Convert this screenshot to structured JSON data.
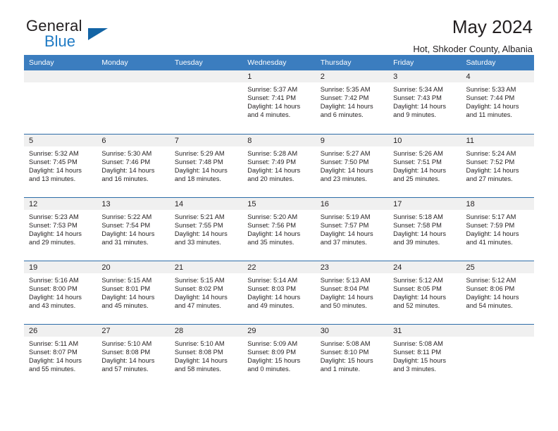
{
  "brand": {
    "name_part1": "General",
    "name_part2": "Blue"
  },
  "header": {
    "title": "May 2024",
    "subtitle": "Hot, Shkoder County, Albania"
  },
  "colors": {
    "header_blue": "#3b7dbf",
    "row_divider": "#2d6ca8",
    "daynum_bg": "#f0f0f0",
    "brand_blue": "#1f7ac4",
    "text": "#231f20"
  },
  "weekday_headers": [
    "Sunday",
    "Monday",
    "Tuesday",
    "Wednesday",
    "Thursday",
    "Friday",
    "Saturday"
  ],
  "weeks": [
    [
      {
        "day": "",
        "sunrise": "",
        "sunset": "",
        "daylight1": "",
        "daylight2": ""
      },
      {
        "day": "",
        "sunrise": "",
        "sunset": "",
        "daylight1": "",
        "daylight2": ""
      },
      {
        "day": "",
        "sunrise": "",
        "sunset": "",
        "daylight1": "",
        "daylight2": ""
      },
      {
        "day": "1",
        "sunrise": "Sunrise: 5:37 AM",
        "sunset": "Sunset: 7:41 PM",
        "daylight1": "Daylight: 14 hours",
        "daylight2": "and 4 minutes."
      },
      {
        "day": "2",
        "sunrise": "Sunrise: 5:35 AM",
        "sunset": "Sunset: 7:42 PM",
        "daylight1": "Daylight: 14 hours",
        "daylight2": "and 6 minutes."
      },
      {
        "day": "3",
        "sunrise": "Sunrise: 5:34 AM",
        "sunset": "Sunset: 7:43 PM",
        "daylight1": "Daylight: 14 hours",
        "daylight2": "and 9 minutes."
      },
      {
        "day": "4",
        "sunrise": "Sunrise: 5:33 AM",
        "sunset": "Sunset: 7:44 PM",
        "daylight1": "Daylight: 14 hours",
        "daylight2": "and 11 minutes."
      }
    ],
    [
      {
        "day": "5",
        "sunrise": "Sunrise: 5:32 AM",
        "sunset": "Sunset: 7:45 PM",
        "daylight1": "Daylight: 14 hours",
        "daylight2": "and 13 minutes."
      },
      {
        "day": "6",
        "sunrise": "Sunrise: 5:30 AM",
        "sunset": "Sunset: 7:46 PM",
        "daylight1": "Daylight: 14 hours",
        "daylight2": "and 16 minutes."
      },
      {
        "day": "7",
        "sunrise": "Sunrise: 5:29 AM",
        "sunset": "Sunset: 7:48 PM",
        "daylight1": "Daylight: 14 hours",
        "daylight2": "and 18 minutes."
      },
      {
        "day": "8",
        "sunrise": "Sunrise: 5:28 AM",
        "sunset": "Sunset: 7:49 PM",
        "daylight1": "Daylight: 14 hours",
        "daylight2": "and 20 minutes."
      },
      {
        "day": "9",
        "sunrise": "Sunrise: 5:27 AM",
        "sunset": "Sunset: 7:50 PM",
        "daylight1": "Daylight: 14 hours",
        "daylight2": "and 23 minutes."
      },
      {
        "day": "10",
        "sunrise": "Sunrise: 5:26 AM",
        "sunset": "Sunset: 7:51 PM",
        "daylight1": "Daylight: 14 hours",
        "daylight2": "and 25 minutes."
      },
      {
        "day": "11",
        "sunrise": "Sunrise: 5:24 AM",
        "sunset": "Sunset: 7:52 PM",
        "daylight1": "Daylight: 14 hours",
        "daylight2": "and 27 minutes."
      }
    ],
    [
      {
        "day": "12",
        "sunrise": "Sunrise: 5:23 AM",
        "sunset": "Sunset: 7:53 PM",
        "daylight1": "Daylight: 14 hours",
        "daylight2": "and 29 minutes."
      },
      {
        "day": "13",
        "sunrise": "Sunrise: 5:22 AM",
        "sunset": "Sunset: 7:54 PM",
        "daylight1": "Daylight: 14 hours",
        "daylight2": "and 31 minutes."
      },
      {
        "day": "14",
        "sunrise": "Sunrise: 5:21 AM",
        "sunset": "Sunset: 7:55 PM",
        "daylight1": "Daylight: 14 hours",
        "daylight2": "and 33 minutes."
      },
      {
        "day": "15",
        "sunrise": "Sunrise: 5:20 AM",
        "sunset": "Sunset: 7:56 PM",
        "daylight1": "Daylight: 14 hours",
        "daylight2": "and 35 minutes."
      },
      {
        "day": "16",
        "sunrise": "Sunrise: 5:19 AM",
        "sunset": "Sunset: 7:57 PM",
        "daylight1": "Daylight: 14 hours",
        "daylight2": "and 37 minutes."
      },
      {
        "day": "17",
        "sunrise": "Sunrise: 5:18 AM",
        "sunset": "Sunset: 7:58 PM",
        "daylight1": "Daylight: 14 hours",
        "daylight2": "and 39 minutes."
      },
      {
        "day": "18",
        "sunrise": "Sunrise: 5:17 AM",
        "sunset": "Sunset: 7:59 PM",
        "daylight1": "Daylight: 14 hours",
        "daylight2": "and 41 minutes."
      }
    ],
    [
      {
        "day": "19",
        "sunrise": "Sunrise: 5:16 AM",
        "sunset": "Sunset: 8:00 PM",
        "daylight1": "Daylight: 14 hours",
        "daylight2": "and 43 minutes."
      },
      {
        "day": "20",
        "sunrise": "Sunrise: 5:15 AM",
        "sunset": "Sunset: 8:01 PM",
        "daylight1": "Daylight: 14 hours",
        "daylight2": "and 45 minutes."
      },
      {
        "day": "21",
        "sunrise": "Sunrise: 5:15 AM",
        "sunset": "Sunset: 8:02 PM",
        "daylight1": "Daylight: 14 hours",
        "daylight2": "and 47 minutes."
      },
      {
        "day": "22",
        "sunrise": "Sunrise: 5:14 AM",
        "sunset": "Sunset: 8:03 PM",
        "daylight1": "Daylight: 14 hours",
        "daylight2": "and 49 minutes."
      },
      {
        "day": "23",
        "sunrise": "Sunrise: 5:13 AM",
        "sunset": "Sunset: 8:04 PM",
        "daylight1": "Daylight: 14 hours",
        "daylight2": "and 50 minutes."
      },
      {
        "day": "24",
        "sunrise": "Sunrise: 5:12 AM",
        "sunset": "Sunset: 8:05 PM",
        "daylight1": "Daylight: 14 hours",
        "daylight2": "and 52 minutes."
      },
      {
        "day": "25",
        "sunrise": "Sunrise: 5:12 AM",
        "sunset": "Sunset: 8:06 PM",
        "daylight1": "Daylight: 14 hours",
        "daylight2": "and 54 minutes."
      }
    ],
    [
      {
        "day": "26",
        "sunrise": "Sunrise: 5:11 AM",
        "sunset": "Sunset: 8:07 PM",
        "daylight1": "Daylight: 14 hours",
        "daylight2": "and 55 minutes."
      },
      {
        "day": "27",
        "sunrise": "Sunrise: 5:10 AM",
        "sunset": "Sunset: 8:08 PM",
        "daylight1": "Daylight: 14 hours",
        "daylight2": "and 57 minutes."
      },
      {
        "day": "28",
        "sunrise": "Sunrise: 5:10 AM",
        "sunset": "Sunset: 8:08 PM",
        "daylight1": "Daylight: 14 hours",
        "daylight2": "and 58 minutes."
      },
      {
        "day": "29",
        "sunrise": "Sunrise: 5:09 AM",
        "sunset": "Sunset: 8:09 PM",
        "daylight1": "Daylight: 15 hours",
        "daylight2": "and 0 minutes."
      },
      {
        "day": "30",
        "sunrise": "Sunrise: 5:08 AM",
        "sunset": "Sunset: 8:10 PM",
        "daylight1": "Daylight: 15 hours",
        "daylight2": "and 1 minute."
      },
      {
        "day": "31",
        "sunrise": "Sunrise: 5:08 AM",
        "sunset": "Sunset: 8:11 PM",
        "daylight1": "Daylight: 15 hours",
        "daylight2": "and 3 minutes."
      },
      {
        "day": "",
        "sunrise": "",
        "sunset": "",
        "daylight1": "",
        "daylight2": ""
      }
    ]
  ]
}
